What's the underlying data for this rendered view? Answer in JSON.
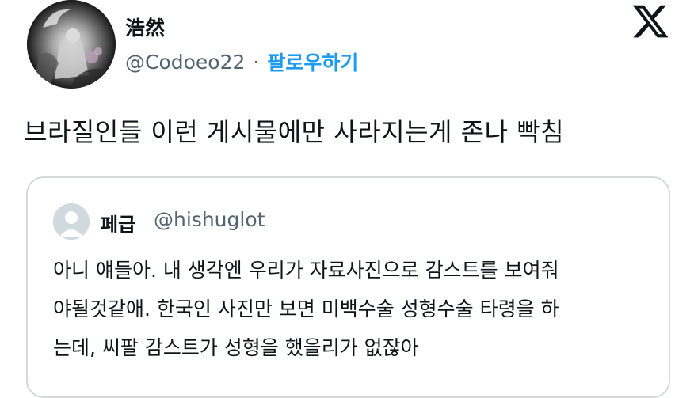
{
  "author": {
    "display_name": "浩然",
    "handle": "@Codoeo22",
    "separator": "·",
    "follow_label": "팔로우하기"
  },
  "tweet": {
    "text": "브라질인들 이런 게시물에만 사라지는게 존나 빡침"
  },
  "quote": {
    "display_name": "페급",
    "handle": "@hishuglot",
    "lines": [
      "아니 얘들아. 내 생각엔 우리가 자료사진으로 감스트를 보여줘",
      "야될것같애. 한국인 사진만 보면 미백수술 성형수술 타령을 하",
      "는데, 씨팔 감스트가 성형을 했을리가 없잖아"
    ]
  },
  "icons": {
    "logo": "x-logo-icon",
    "author_avatar": "avatar",
    "quote_avatar": "default-avatar-icon"
  },
  "colors": {
    "text": "#0f1419",
    "secondary": "#536471",
    "accent": "#1d9bf0",
    "border": "#d6d9dc"
  }
}
